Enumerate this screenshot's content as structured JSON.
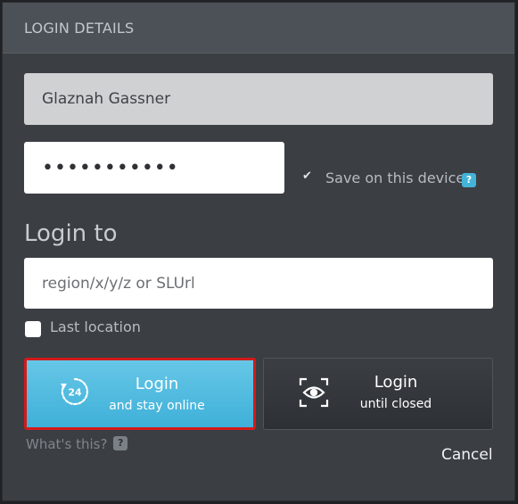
{
  "dialog": {
    "title": "LOGIN DETAILS"
  },
  "form": {
    "username_value": "Glaznah Gassner",
    "password_value": "•••••••••••",
    "save_label": "Save on this device",
    "save_checked": true,
    "help_badge": "?",
    "login_to_label": "Login to",
    "region_placeholder": "region/x/y/z or SLUrl",
    "last_location_label": "Last location",
    "last_location_checked": false
  },
  "buttons": {
    "stay_online_main": "Login",
    "stay_online_sub": "and stay online",
    "stay_online_icon_text": "24",
    "until_closed_main": "Login",
    "until_closed_sub": "until closed",
    "whats_this": "What's this?",
    "cancel": "Cancel"
  },
  "colors": {
    "accent_blue": "#43b3d8",
    "focus_border": "#d21a1a",
    "panel_bg": "#3b3f44"
  },
  "icons": {
    "stay_online": "clock-24-icon",
    "until_closed": "eye-focus-icon",
    "save_check": "checkmark-icon",
    "help": "help-icon"
  }
}
